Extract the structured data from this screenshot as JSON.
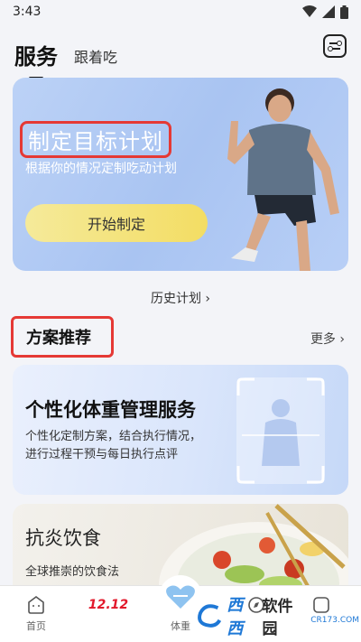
{
  "status_bar": {
    "time": "3:43"
  },
  "header": {
    "tab_active": "服务",
    "tab_other": "跟着吃"
  },
  "hero": {
    "title": "制定目标计划",
    "subtitle": "根据你的情况定制吃动计划",
    "button": "开始制定"
  },
  "history_link": "历史计划",
  "section": {
    "title": "方案推荐",
    "more": "更多"
  },
  "cards": [
    {
      "title": "个性化体重管理服务",
      "desc_line1": "个性化定制方案，结合执行情况，",
      "desc_line2": "进行过程干预与每日执行点评"
    },
    {
      "title": "抗炎饮食",
      "desc": "全球推崇的饮食法"
    }
  ],
  "bottom_nav": {
    "home": "首页",
    "promo": "12.12",
    "body": "体重"
  },
  "watermark": {
    "brand": "西西",
    "name": "软件园",
    "domain": "CR173.COM"
  },
  "colors": {
    "highlight_box": "#e53935",
    "hero_button": "#f3dd63",
    "promo": "#e2182b",
    "watermark_blue": "#1e78d6"
  }
}
